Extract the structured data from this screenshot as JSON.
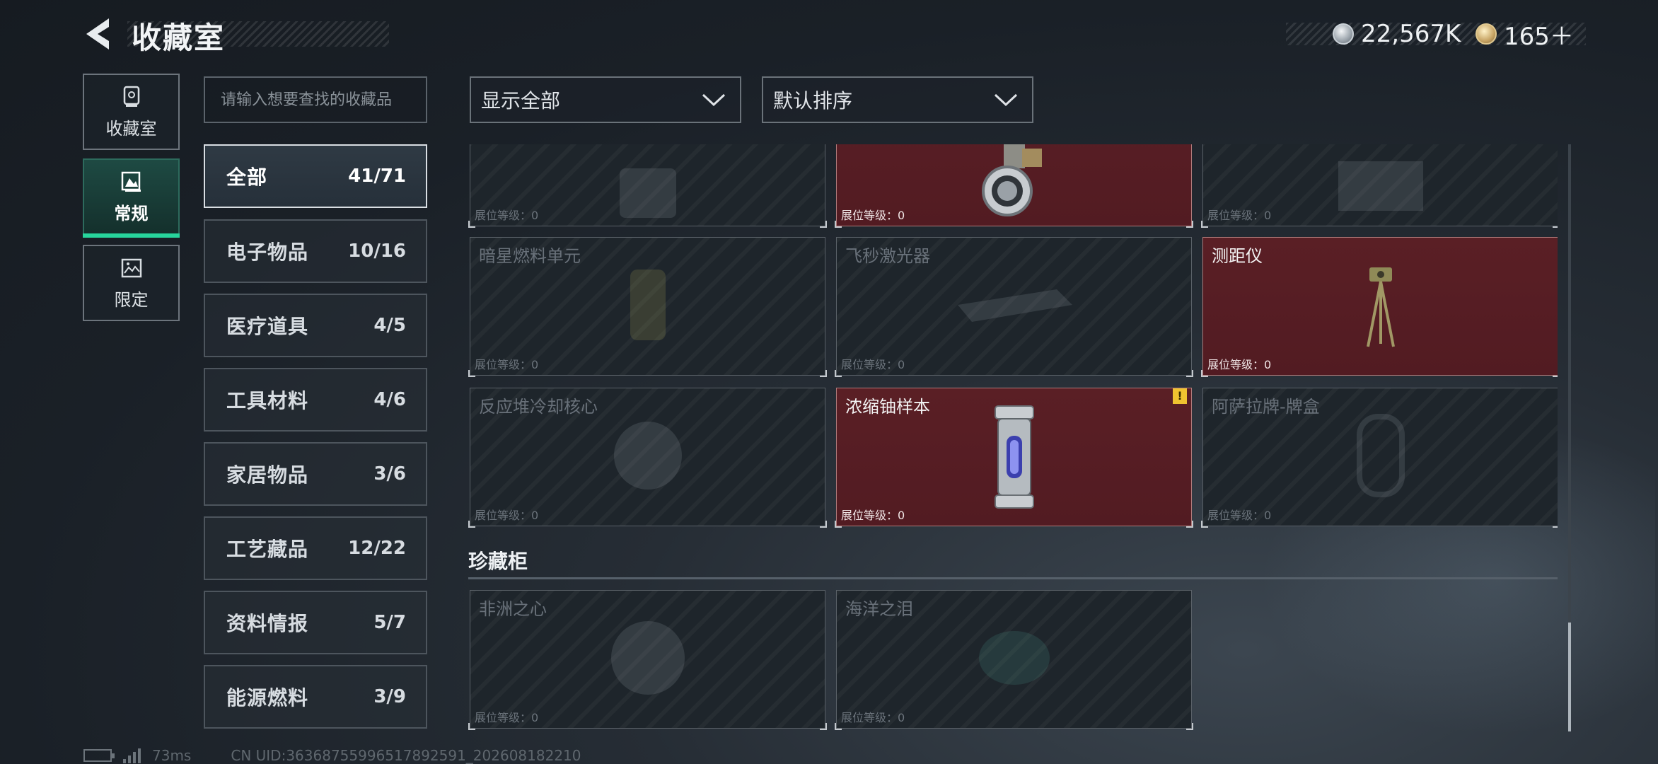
{
  "header": {
    "title": "收藏室",
    "currency": [
      {
        "icon": "silver-coin-icon",
        "amount": "22,567K"
      },
      {
        "icon": "gold-coin-icon",
        "amount": "165＋"
      }
    ]
  },
  "mode_tabs": [
    {
      "label": "收藏室",
      "icon": "trophy-icon",
      "active": false
    },
    {
      "label": "常规",
      "icon": "picture-frame-icon",
      "active": true
    },
    {
      "label": "限定",
      "icon": "landscape-icon",
      "active": false
    }
  ],
  "search": {
    "placeholder": "请输入想要查找的收藏品"
  },
  "categories": [
    {
      "name": "全部",
      "count": "41/71",
      "active": true
    },
    {
      "name": "电子物品",
      "count": "10/16"
    },
    {
      "name": "医疗道具",
      "count": "4/5"
    },
    {
      "name": "工具材料",
      "count": "4/6"
    },
    {
      "name": "家居物品",
      "count": "3/6"
    },
    {
      "name": "工艺藏品",
      "count": "12/22"
    },
    {
      "name": "资料情报",
      "count": "5/7"
    },
    {
      "name": "能源燃料",
      "count": "3/9"
    }
  ],
  "filters": {
    "display": "显示全部",
    "sort": "默认排序"
  },
  "level_label": "展位等级：",
  "items": [
    {
      "name": "",
      "level": "0",
      "owned": false
    },
    {
      "name": "",
      "level": "0",
      "owned": true
    },
    {
      "name": "",
      "level": "0",
      "owned": false
    },
    {
      "name": "暗星燃料单元",
      "level": "0",
      "owned": false
    },
    {
      "name": "飞秒激光器",
      "level": "0",
      "owned": false
    },
    {
      "name": "测距仪",
      "level": "0",
      "owned": true
    },
    {
      "name": "反应堆冷却核心",
      "level": "0",
      "owned": false
    },
    {
      "name": "浓缩铀样本",
      "level": "0",
      "owned": true,
      "warning": "!"
    },
    {
      "name": "阿萨拉牌-牌盒",
      "level": "0",
      "owned": false
    }
  ],
  "showcase": {
    "title": "珍藏柜",
    "items": [
      {
        "name": "非洲之心",
        "level": "0",
        "owned": false
      },
      {
        "name": "海洋之泪",
        "level": "0",
        "owned": false
      }
    ]
  },
  "footer": {
    "ping": "73ms",
    "uid": "CN UID:3636875599651789​2591_202608182210"
  }
}
